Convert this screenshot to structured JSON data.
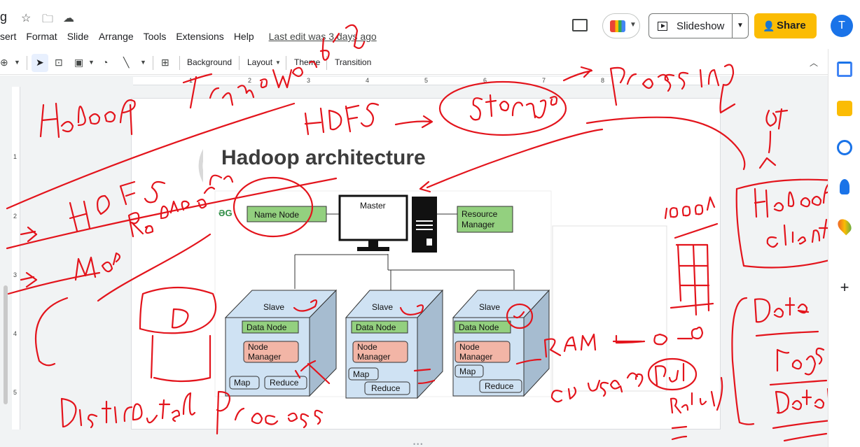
{
  "app": {
    "title_fragment": "g",
    "menu": [
      "sert",
      "Format",
      "Slide",
      "Arrange",
      "Tools",
      "Extensions",
      "Help"
    ],
    "last_edit": "Last edit was 3 days ago",
    "slideshow_label": "Slideshow",
    "share_label": "Share",
    "avatar_letter": "T"
  },
  "toolbar": {
    "background": "Background",
    "layout": "Layout",
    "theme": "Theme",
    "transition": "Transition"
  },
  "ruler": {
    "h": [
      "1",
      "2",
      "3",
      "4",
      "5",
      "6",
      "7",
      "8"
    ],
    "v": [
      "1",
      "2",
      "3",
      "4",
      "5"
    ]
  },
  "slide": {
    "title": "Hadoop architecture",
    "logo": "ƏG",
    "name_node": "Name Node",
    "master": "Master",
    "resource_manager_1": "Resource",
    "resource_manager_2": "Manager",
    "slave_label": "Slave",
    "data_node": "Data Node",
    "node_manager_1": "Node",
    "node_manager_2": "Manager",
    "map": "Map",
    "reduce": "Reduce"
  },
  "colors": {
    "share": "#fbbc04",
    "avatar": "#1a73e8",
    "ink": "#e3141c",
    "green_box": "#93d07f",
    "red_box": "#f2b5a6",
    "slave_face": "#cfe2f3",
    "slave_side": "#a6bcd0"
  },
  "icons": [
    "star-icon",
    "folder-icon",
    "cloud-icon",
    "comment-icon",
    "meet-icon",
    "present-icon",
    "share-person-icon",
    "calendar-icon",
    "keep-icon",
    "tasks-icon",
    "contacts-icon",
    "maps-icon",
    "plus-icon"
  ]
}
